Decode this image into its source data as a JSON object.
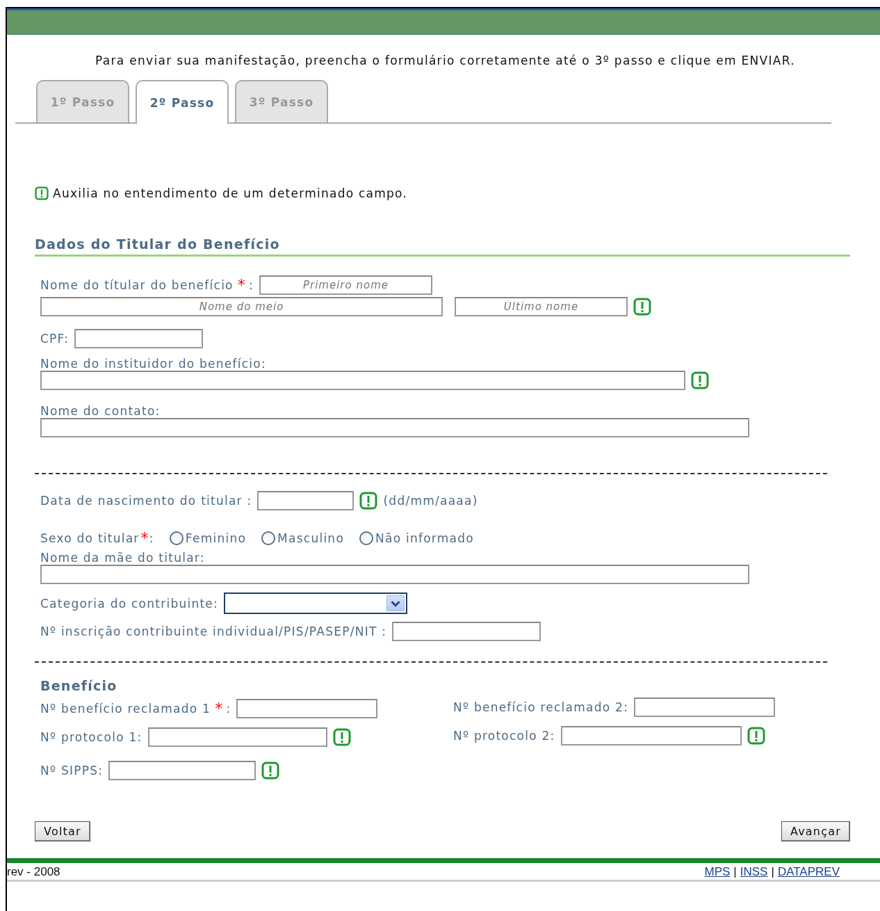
{
  "intro": "Para enviar sua manifestação, preencha o formulário corretamente até o 3º passo e clique em ENVIAR.",
  "tabs": [
    {
      "label": "1º Passo",
      "selected": false
    },
    {
      "label": "2º Passo",
      "selected": true
    },
    {
      "label": "3º Passo",
      "selected": false
    }
  ],
  "help_note": "Auxilia no entendimento de um determinado campo.",
  "required_mark": "*",
  "titular": {
    "heading": "Dados do Titular do Benefício",
    "name": {
      "label": "Nome do títular do benefício",
      "required": true,
      "suffix": ":",
      "help": true,
      "fields": [
        {
          "placeholder": "Primeiro nome"
        },
        {
          "placeholder": "Nome do meio"
        },
        {
          "placeholder": "Último nome"
        }
      ]
    },
    "cpf": {
      "label": "CPF:"
    },
    "instituidor": {
      "label": "Nome do instituidor do benefício:",
      "help": true
    },
    "contato": {
      "label": "Nome do contato:",
      "help": false
    }
  },
  "details": {
    "birth": {
      "label": "Data de nascimento do titular :",
      "help": true,
      "hint": "(dd/mm/aaaa)"
    },
    "sex": {
      "label": "Sexo do titular",
      "required": true,
      "suffix": ":",
      "options": [
        {
          "label": "Feminino",
          "selected": false
        },
        {
          "label": "Masculino",
          "selected": false
        },
        {
          "label": "Não informado",
          "selected": false
        }
      ]
    },
    "mother": {
      "label": "Nome da mãe do titular:"
    },
    "category": {
      "label": "Categoria do contribuinte:"
    },
    "registration": {
      "label": "Nº inscrição contribuinte individual/PIS/PASEP/NIT :"
    }
  },
  "benefit": {
    "heading": "Benefício",
    "fields": [
      {
        "label": "Nº benefício reclamado 1",
        "required": true,
        "suffix": ":",
        "help": false
      },
      {
        "label": "Nº benefício reclamado 2:",
        "required": false,
        "help": false
      },
      {
        "label": "Nº protocolo 1:",
        "required": false,
        "help": true
      },
      {
        "label": "Nº protocolo 2:",
        "required": false,
        "help": true
      },
      {
        "label": "Nº SIPPS:",
        "required": false,
        "help": true
      }
    ]
  },
  "buttons": [
    "Voltar",
    "Avançar"
  ],
  "footer": {
    "copyright": "rev - 2008",
    "links": [
      "MPS",
      "INSS",
      "DATAPREV"
    ],
    "separator": "|"
  }
}
